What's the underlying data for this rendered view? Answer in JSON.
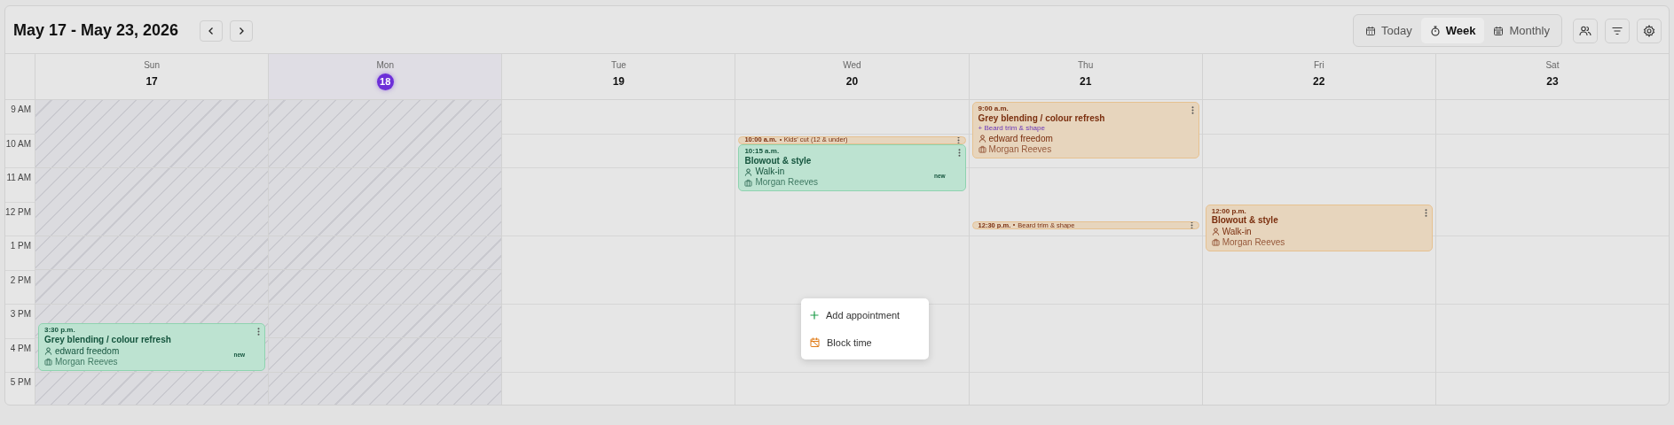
{
  "header": {
    "title": "May 17 - May 23, 2026"
  },
  "views": [
    {
      "kind": "day",
      "label": "Today",
      "selected": false
    },
    {
      "kind": "week",
      "label": "Week",
      "selected": true
    },
    {
      "kind": "month",
      "label": "Monthly",
      "selected": false
    }
  ],
  "time_labels": [
    "9 AM",
    "10 AM",
    "11 AM",
    "12 PM",
    "1 PM",
    "2 PM",
    "3 PM",
    "4 PM",
    "5 PM"
  ],
  "days": [
    {
      "weekday": "Sun",
      "date": "17",
      "today": false,
      "unavailable": true,
      "events": [
        {
          "kind": "card",
          "color": "#bde3d1",
          "time": "3:30 p.m.",
          "title": "Grey blending / colour refresh",
          "client": "edward freedom",
          "staff": "Morgan Reeves",
          "badge": "new"
        }
      ]
    },
    {
      "weekday": "Mon",
      "date": "18",
      "today": true,
      "unavailable": true
    },
    {
      "weekday": "Tue",
      "date": "19",
      "today": false,
      "unavailable": false
    },
    {
      "weekday": "Wed",
      "date": "20",
      "today": false,
      "unavailable": false,
      "events": [
        {
          "kind": "compact",
          "color": "#e7d5bd",
          "time": "10:00 a.m.",
          "title": "Kids' cut (12 & under)"
        },
        {
          "kind": "card",
          "color": "#bde3d1",
          "time": "10:15 a.m.",
          "title": "Blowout & style",
          "client": "Walk-in",
          "staff": "Morgan Reeves",
          "badge": "new"
        }
      ]
    },
    {
      "weekday": "Thu",
      "date": "21",
      "today": false,
      "unavailable": false,
      "events": [
        {
          "kind": "card",
          "color": "#e7d5bd",
          "time": "9:00 a.m.",
          "title": "Grey blending / colour refresh",
          "addon": "+ Beard trim & shape",
          "client": "edward freedom",
          "staff": "Morgan Reeves"
        },
        {
          "kind": "compact",
          "color": "#e7d5bd",
          "time": "12:30 p.m.",
          "title": "Beard trim & shape"
        }
      ]
    },
    {
      "weekday": "Fri",
      "date": "22",
      "today": false,
      "unavailable": false,
      "events": [
        {
          "kind": "card",
          "color": "#e7d5bd",
          "time": "12:00 p.m.",
          "title": "Blowout & style",
          "client": "Walk-in",
          "staff": "Morgan Reeves"
        }
      ]
    },
    {
      "weekday": "Sat",
      "date": "23",
      "today": false,
      "unavailable": false
    }
  ],
  "context_menu": {
    "items": [
      {
        "kind": "add",
        "label": "Add appointment"
      },
      {
        "kind": "block",
        "label": "Block time"
      }
    ]
  }
}
